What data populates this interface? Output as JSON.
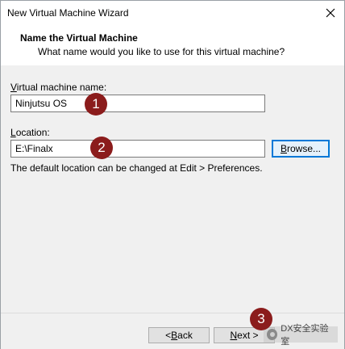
{
  "window": {
    "title": "New Virtual Machine Wizard"
  },
  "header": {
    "title": "Name the Virtual Machine",
    "subtitle": "What name would you like to use for this virtual machine?"
  },
  "form": {
    "vm_name_label_prefix": "V",
    "vm_name_label_rest": "irtual machine name:",
    "vm_name_value": "Ninjutsu OS",
    "location_label_prefix": "L",
    "location_label_rest": "ocation:",
    "location_value": "E:\\Finalx",
    "browse_prefix": "B",
    "browse_rest": "rowse...",
    "hint": "The default location can be changed at Edit > Preferences."
  },
  "footer": {
    "back_prefix": "< ",
    "back_underline": "B",
    "back_rest": "ack",
    "next_underline": "N",
    "next_rest": "ext >"
  },
  "callouts": [
    "1",
    "2",
    "3"
  ],
  "watermark": {
    "text": "DX安全实验室"
  },
  "colors": {
    "callout": "#8b1c1c",
    "focus_border": "#0078d7"
  }
}
